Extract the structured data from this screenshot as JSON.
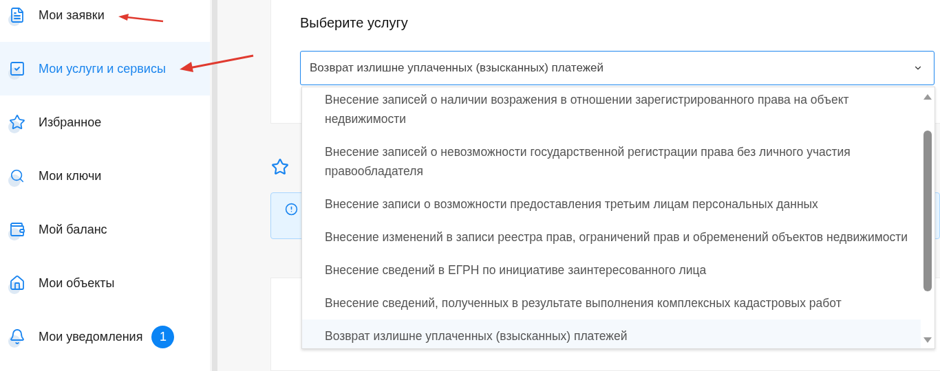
{
  "sidebar": {
    "items": [
      {
        "label": "Мои заявки",
        "selected": false
      },
      {
        "label": "Мои услуги и сервисы",
        "selected": true
      },
      {
        "label": "Избранное",
        "selected": false
      },
      {
        "label": "Мои ключи",
        "selected": false
      },
      {
        "label": "Мой баланс",
        "selected": false
      },
      {
        "label": "Мои объекты",
        "selected": false
      },
      {
        "label": "Мои уведомления",
        "selected": false,
        "badge": "1"
      }
    ]
  },
  "service_card": {
    "title": "Выберите услугу",
    "select": {
      "value": "Возврат излишне уплаченных (взысканных) платежей",
      "expanded": true,
      "options": [
        {
          "label": "Внесение записей о наличии возражения в отношении зарегистрированного права на объект недвижимости",
          "selected": false
        },
        {
          "label": "Внесение записей о невозможности государственной регистрации права без личного участия правообладателя",
          "selected": false
        },
        {
          "label": "Внесение записи о возможности предоставления третьим лицам персональных данных",
          "selected": false
        },
        {
          "label": "Внесение изменений в записи реестра прав, ограничений прав и обременений объектов недвижимости",
          "selected": false
        },
        {
          "label": "Внесение сведений в ЕГРН по инициативе заинтересованного лица",
          "selected": false
        },
        {
          "label": "Внесение сведений, полученных в результате выполнения комплексных кадастровых работ",
          "selected": false
        },
        {
          "label": "Возврат излишне уплаченных (взысканных) платежей",
          "selected": true
        }
      ]
    }
  }
}
